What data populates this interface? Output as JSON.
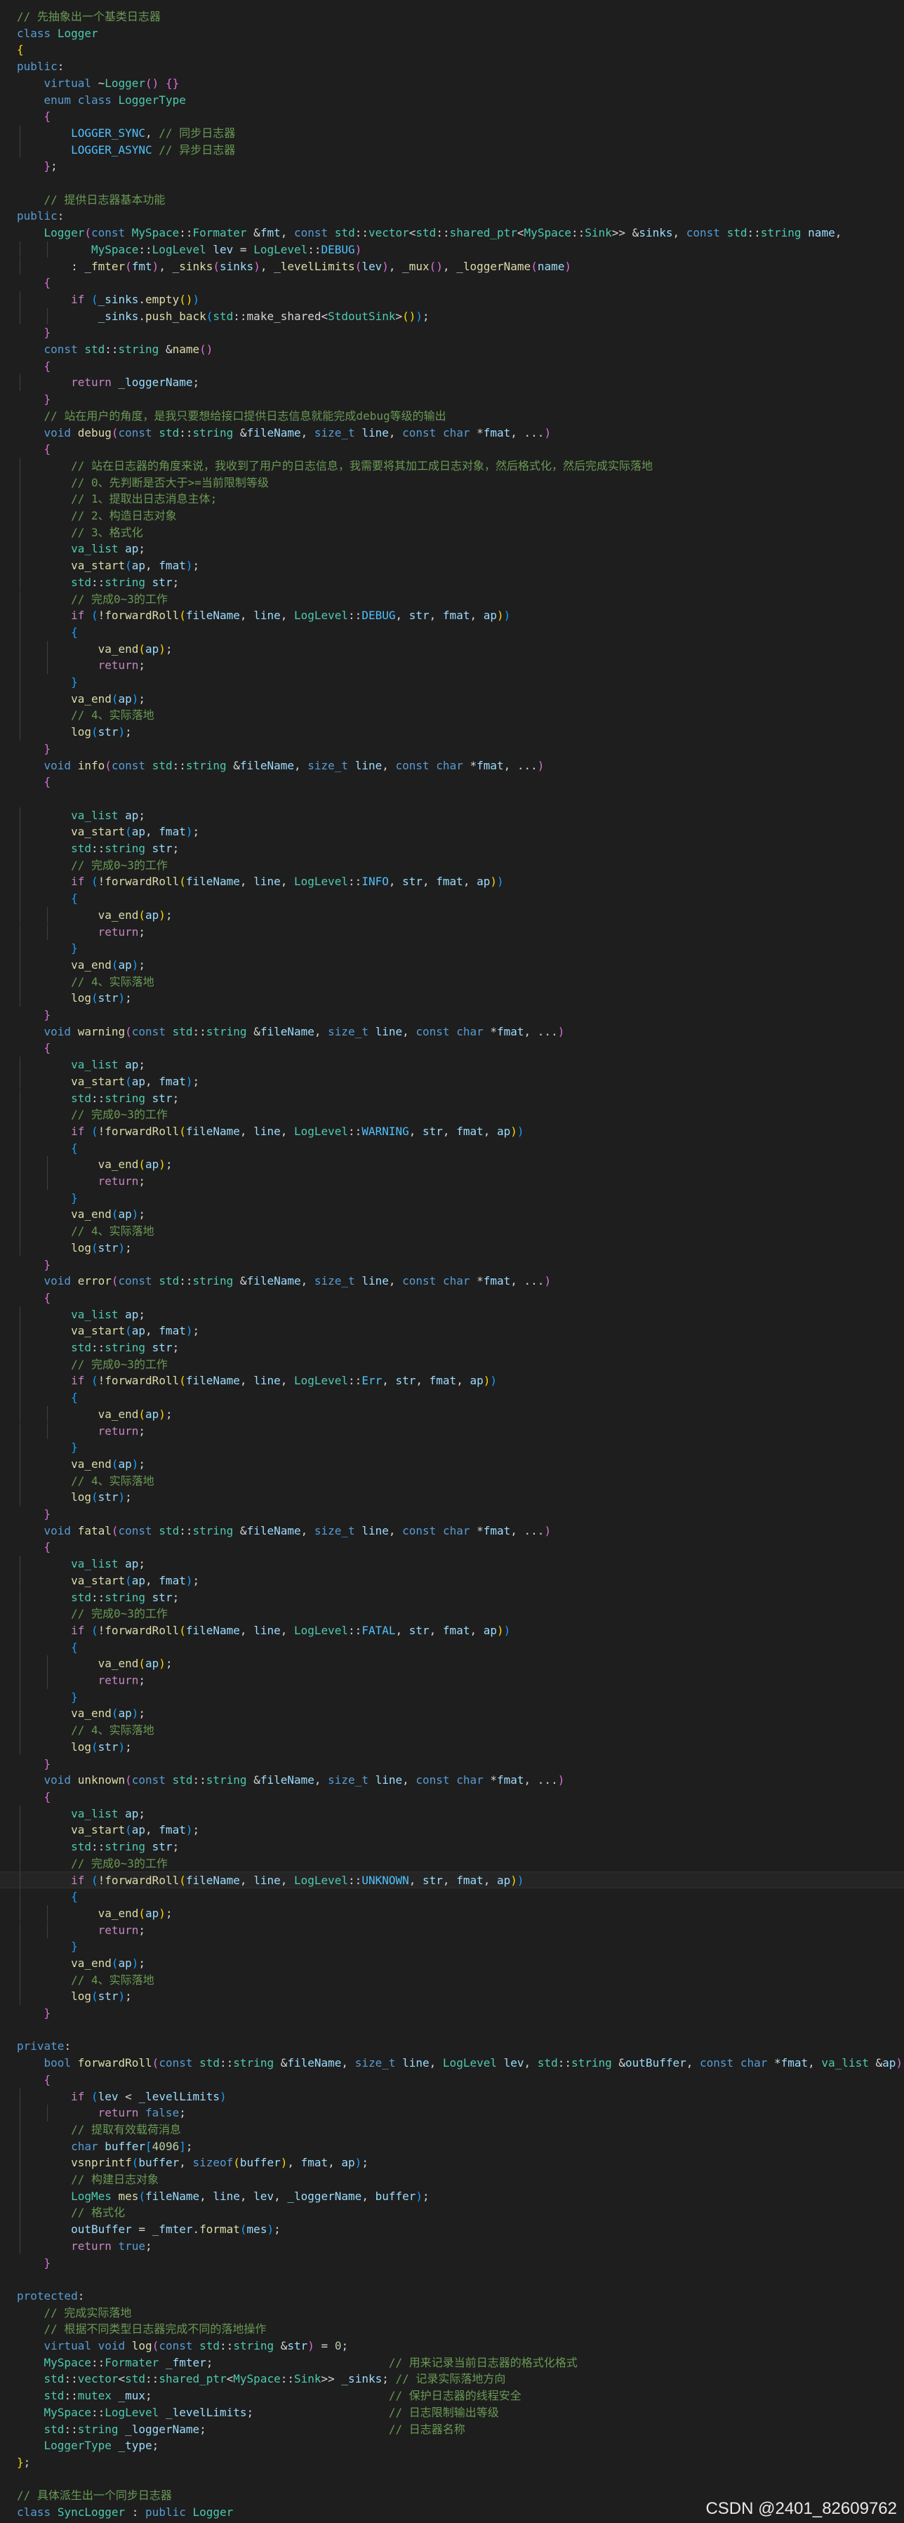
{
  "colors": {
    "text": "#d4d4d4",
    "keyword": "#569cd6",
    "control": "#c586c0",
    "type": "#4ec9b0",
    "function": "#dcdcaa",
    "variable": "#9cdcfe",
    "number": "#b5cea8",
    "comment": "#6a9955",
    "enum": "#4fc1ff",
    "brace": "#ffd700",
    "brace2": "#da70d6",
    "brace3": "#179fff",
    "background": "#1e1e1e"
  },
  "watermark": "CSDN @2401_82609762",
  "lines": [
    {
      "text": "// 先抽象出一个基类日志器"
    },
    {
      "text": "class Logger"
    },
    {
      "text": "{"
    },
    {
      "text": "public:"
    },
    {
      "text": "    virtual ~Logger() {}"
    },
    {
      "text": "    enum class LoggerType"
    },
    {
      "text": "    {"
    },
    {
      "text": "        LOGGER_SYNC, // 同步日志器"
    },
    {
      "text": "        LOGGER_ASYNC // 异步日志器"
    },
    {
      "text": "    };"
    },
    {
      "text": ""
    },
    {
      "text": "    // 提供日志器基本功能"
    },
    {
      "text": "public:"
    },
    {
      "text": "    Logger(const MySpace::Formater &fmt, const std::vector<std::shared_ptr<MySpace::Sink>> &sinks, const std::string name,"
    },
    {
      "text": "           MySpace::LogLevel lev = LogLevel::DEBUG)"
    },
    {
      "text": "        : _fmter(fmt), _sinks(sinks), _levelLimits(lev), _mux(), _loggerName(name)"
    },
    {
      "text": "    {"
    },
    {
      "text": "        if (_sinks.empty())"
    },
    {
      "text": "            _sinks.push_back(std::make_shared<StdoutSink>());"
    },
    {
      "text": "    }"
    },
    {
      "text": "    const std::string &name()"
    },
    {
      "text": "    {"
    },
    {
      "text": "        return _loggerName;"
    },
    {
      "text": "    }"
    },
    {
      "text": "    // 站在用户的角度，是我只要想给接口提供日志信息就能完成debug等级的输出"
    },
    {
      "text": "    void debug(const std::string &fileName, size_t line, const char *fmat, ...)"
    },
    {
      "text": "    {"
    },
    {
      "text": "        // 站在日志器的角度来说，我收到了用户的日志信息，我需要将其加工成日志对象，然后格式化，然后完成实际落地"
    },
    {
      "text": "        // 0、先判断是否大于>=当前限制等级"
    },
    {
      "text": "        // 1、提取出日志消息主体;"
    },
    {
      "text": "        // 2、构造日志对象"
    },
    {
      "text": "        // 3、格式化"
    },
    {
      "text": "        va_list ap;"
    },
    {
      "text": "        va_start(ap, fmat);"
    },
    {
      "text": "        std::string str;"
    },
    {
      "text": "        // 完成0~3的工作"
    },
    {
      "text": "        if (!forwardRoll(fileName, line, LogLevel::DEBUG, str, fmat, ap))"
    },
    {
      "text": "        {"
    },
    {
      "text": "            va_end(ap);"
    },
    {
      "text": "            return;"
    },
    {
      "text": "        }"
    },
    {
      "text": "        va_end(ap);"
    },
    {
      "text": "        // 4、实际落地"
    },
    {
      "text": "        log(str);"
    },
    {
      "text": "    }"
    },
    {
      "text": "    void info(const std::string &fileName, size_t line, const char *fmat, ...)"
    },
    {
      "text": "    {"
    },
    {
      "text": ""
    },
    {
      "text": "        va_list ap;"
    },
    {
      "text": "        va_start(ap, fmat);"
    },
    {
      "text": "        std::string str;"
    },
    {
      "text": "        // 完成0~3的工作"
    },
    {
      "text": "        if (!forwardRoll(fileName, line, LogLevel::INFO, str, fmat, ap))"
    },
    {
      "text": "        {"
    },
    {
      "text": "            va_end(ap);"
    },
    {
      "text": "            return;"
    },
    {
      "text": "        }"
    },
    {
      "text": "        va_end(ap);"
    },
    {
      "text": "        // 4、实际落地"
    },
    {
      "text": "        log(str);"
    },
    {
      "text": "    }"
    },
    {
      "text": "    void warning(const std::string &fileName, size_t line, const char *fmat, ...)"
    },
    {
      "text": "    {"
    },
    {
      "text": "        va_list ap;"
    },
    {
      "text": "        va_start(ap, fmat);"
    },
    {
      "text": "        std::string str;"
    },
    {
      "text": "        // 完成0~3的工作"
    },
    {
      "text": "        if (!forwardRoll(fileName, line, LogLevel::WARNING, str, fmat, ap))"
    },
    {
      "text": "        {"
    },
    {
      "text": "            va_end(ap);"
    },
    {
      "text": "            return;"
    },
    {
      "text": "        }"
    },
    {
      "text": "        va_end(ap);"
    },
    {
      "text": "        // 4、实际落地"
    },
    {
      "text": "        log(str);"
    },
    {
      "text": "    }"
    },
    {
      "text": "    void error(const std::string &fileName, size_t line, const char *fmat, ...)"
    },
    {
      "text": "    {"
    },
    {
      "text": "        va_list ap;"
    },
    {
      "text": "        va_start(ap, fmat);"
    },
    {
      "text": "        std::string str;"
    },
    {
      "text": "        // 完成0~3的工作"
    },
    {
      "text": "        if (!forwardRoll(fileName, line, LogLevel::Err, str, fmat, ap))"
    },
    {
      "text": "        {"
    },
    {
      "text": "            va_end(ap);"
    },
    {
      "text": "            return;"
    },
    {
      "text": "        }"
    },
    {
      "text": "        va_end(ap);"
    },
    {
      "text": "        // 4、实际落地"
    },
    {
      "text": "        log(str);"
    },
    {
      "text": "    }"
    },
    {
      "text": "    void fatal(const std::string &fileName, size_t line, const char *fmat, ...)"
    },
    {
      "text": "    {"
    },
    {
      "text": "        va_list ap;"
    },
    {
      "text": "        va_start(ap, fmat);"
    },
    {
      "text": "        std::string str;"
    },
    {
      "text": "        // 完成0~3的工作"
    },
    {
      "text": "        if (!forwardRoll(fileName, line, LogLevel::FATAL, str, fmat, ap))"
    },
    {
      "text": "        {"
    },
    {
      "text": "            va_end(ap);"
    },
    {
      "text": "            return;"
    },
    {
      "text": "        }"
    },
    {
      "text": "        va_end(ap);"
    },
    {
      "text": "        // 4、实际落地"
    },
    {
      "text": "        log(str);"
    },
    {
      "text": "    }"
    },
    {
      "text": "    void unknown(const std::string &fileName, size_t line, const char *fmat, ...)"
    },
    {
      "text": "    {"
    },
    {
      "text": "        va_list ap;"
    },
    {
      "text": "        va_start(ap, fmat);"
    },
    {
      "text": "        std::string str;"
    },
    {
      "text": "        // 完成0~3的工作"
    },
    {
      "text": "        if (!forwardRoll(fileName, line, LogLevel::UNKNOWN, str, fmat, ap))",
      "current": true
    },
    {
      "text": "        {"
    },
    {
      "text": "            va_end(ap);"
    },
    {
      "text": "            return;"
    },
    {
      "text": "        }"
    },
    {
      "text": "        va_end(ap);"
    },
    {
      "text": "        // 4、实际落地"
    },
    {
      "text": "        log(str);"
    },
    {
      "text": "    }"
    },
    {
      "text": ""
    },
    {
      "text": "private:"
    },
    {
      "text": "    bool forwardRoll(const std::string &fileName, size_t line, LogLevel lev, std::string &outBuffer, const char *fmat, va_list &ap)"
    },
    {
      "text": "    {"
    },
    {
      "text": "        if (lev < _levelLimits)"
    },
    {
      "text": "            return false;"
    },
    {
      "text": "        // 提取有效载荷消息"
    },
    {
      "text": "        char buffer[4096];"
    },
    {
      "text": "        vsnprintf(buffer, sizeof(buffer), fmat, ap);"
    },
    {
      "text": "        // 构建日志对象"
    },
    {
      "text": "        LogMes mes(fileName, line, lev, _loggerName, buffer);"
    },
    {
      "text": "        // 格式化"
    },
    {
      "text": "        outBuffer = _fmter.format(mes);"
    },
    {
      "text": "        return true;"
    },
    {
      "text": "    }"
    },
    {
      "text": ""
    },
    {
      "text": "protected:"
    },
    {
      "text": "    // 完成实际落地"
    },
    {
      "text": "    // 根据不同类型日志器完成不同的落地操作"
    },
    {
      "text": "    virtual void log(const std::string &str) = 0;"
    },
    {
      "text": "    MySpace::Formater _fmter;                          // 用来记录当前日志器的格式化格式"
    },
    {
      "text": "    std::vector<std::shared_ptr<MySpace::Sink>> _sinks; // 记录实际落地方向"
    },
    {
      "text": "    std::mutex _mux;                                   // 保护日志器的线程安全"
    },
    {
      "text": "    MySpace::LogLevel _levelLimits;                    // 日志限制输出等级"
    },
    {
      "text": "    std::string _loggerName;                           // 日志器名称"
    },
    {
      "text": "    LoggerType _type;"
    },
    {
      "text": "};"
    },
    {
      "text": ""
    },
    {
      "text": "// 具体派生出一个同步日志器"
    },
    {
      "text": "class SyncLogger : public Logger"
    }
  ]
}
